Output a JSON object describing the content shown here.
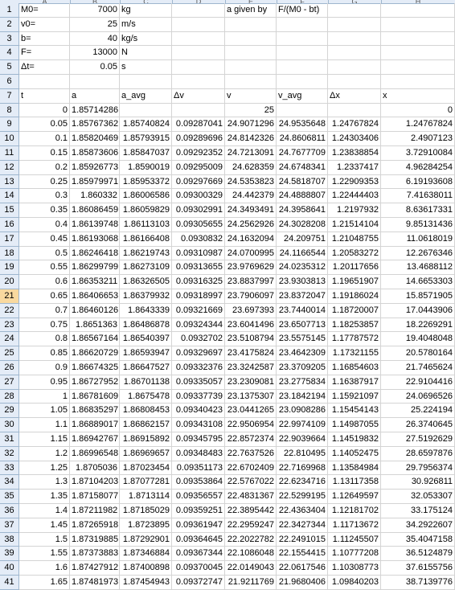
{
  "column_headers": [
    "A",
    "B",
    "C",
    "D",
    "E",
    "F",
    "G",
    "H"
  ],
  "selected_row": "21",
  "params": [
    {
      "row": "1",
      "A": "M0=",
      "B": "7000",
      "C": "kg",
      "E": "a given by",
      "F": "F/(M0 - bt)"
    },
    {
      "row": "2",
      "A": "v0=",
      "B": "25",
      "C": "m/s"
    },
    {
      "row": "3",
      "A": "b=",
      "B": "40",
      "C": "kg/s"
    },
    {
      "row": "4",
      "A": "F=",
      "B": "13000",
      "C": "N"
    },
    {
      "row": "5",
      "A": "Δt=",
      "B": "0.05",
      "C": "s"
    },
    {
      "row": "6"
    },
    {
      "row": "7",
      "A": "t",
      "B": "a",
      "C": "a_avg",
      "D": "Δv",
      "E": "v",
      "F": "v_avg",
      "G": "Δx",
      "H": "x"
    },
    {
      "row": "8",
      "A": "0",
      "B": "1.85714286",
      "E": "25",
      "H": "0"
    }
  ],
  "data_rows": [
    [
      "9",
      "0.05",
      "1.85767362",
      "1.85740824",
      "0.09287041",
      "24.9071296",
      "24.9535648",
      "1.24767824",
      "1.24767824"
    ],
    [
      "10",
      "0.1",
      "1.85820469",
      "1.85793915",
      "0.09289696",
      "24.8142326",
      "24.8606811",
      "1.24303406",
      "2.4907123"
    ],
    [
      "11",
      "0.15",
      "1.85873606",
      "1.85847037",
      "0.09292352",
      "24.7213091",
      "24.7677709",
      "1.23838854",
      "3.72910084"
    ],
    [
      "12",
      "0.2",
      "1.85926773",
      "1.8590019",
      "0.09295009",
      "24.628359",
      "24.6748341",
      "1.2337417",
      "4.96284254"
    ],
    [
      "13",
      "0.25",
      "1.85979971",
      "1.85953372",
      "0.09297669",
      "24.5353823",
      "24.5818707",
      "1.22909353",
      "6.19193608"
    ],
    [
      "14",
      "0.3",
      "1.860332",
      "1.86006586",
      "0.09300329",
      "24.442379",
      "24.4888807",
      "1.22444403",
      "7.41638011"
    ],
    [
      "15",
      "0.35",
      "1.86086459",
      "1.86059829",
      "0.09302991",
      "24.3493491",
      "24.3958641",
      "1.2197932",
      "8.63617331"
    ],
    [
      "16",
      "0.4",
      "1.86139748",
      "1.86113103",
      "0.09305655",
      "24.2562926",
      "24.3028208",
      "1.21514104",
      "9.85131436"
    ],
    [
      "17",
      "0.45",
      "1.86193068",
      "1.86166408",
      "0.0930832",
      "24.1632094",
      "24.209751",
      "1.21048755",
      "11.0618019"
    ],
    [
      "18",
      "0.5",
      "1.86246418",
      "1.86219743",
      "0.09310987",
      "24.0700995",
      "24.1166544",
      "1.20583272",
      "12.2676346"
    ],
    [
      "19",
      "0.55",
      "1.86299799",
      "1.86273109",
      "0.09313655",
      "23.9769629",
      "24.0235312",
      "1.20117656",
      "13.4688112"
    ],
    [
      "20",
      "0.6",
      "1.86353211",
      "1.86326505",
      "0.09316325",
      "23.8837997",
      "23.9303813",
      "1.19651907",
      "14.6653303"
    ],
    [
      "21",
      "0.65",
      "1.86406653",
      "1.86379932",
      "0.09318997",
      "23.7906097",
      "23.8372047",
      "1.19186024",
      "15.8571905"
    ],
    [
      "22",
      "0.7",
      "1.86460126",
      "1.8643339",
      "0.09321669",
      "23.697393",
      "23.7440014",
      "1.18720007",
      "17.0443906"
    ],
    [
      "23",
      "0.75",
      "1.8651363",
      "1.86486878",
      "0.09324344",
      "23.6041496",
      "23.6507713",
      "1.18253857",
      "18.2269291"
    ],
    [
      "24",
      "0.8",
      "1.86567164",
      "1.86540397",
      "0.0932702",
      "23.5108794",
      "23.5575145",
      "1.17787572",
      "19.4048048"
    ],
    [
      "25",
      "0.85",
      "1.86620729",
      "1.86593947",
      "0.09329697",
      "23.4175824",
      "23.4642309",
      "1.17321155",
      "20.5780164"
    ],
    [
      "26",
      "0.9",
      "1.86674325",
      "1.86647527",
      "0.09332376",
      "23.3242587",
      "23.3709205",
      "1.16854603",
      "21.7465624"
    ],
    [
      "27",
      "0.95",
      "1.86727952",
      "1.86701138",
      "0.09335057",
      "23.2309081",
      "23.2775834",
      "1.16387917",
      "22.9104416"
    ],
    [
      "28",
      "1",
      "1.86781609",
      "1.8675478",
      "0.09337739",
      "23.1375307",
      "23.1842194",
      "1.15921097",
      "24.0696526"
    ],
    [
      "29",
      "1.05",
      "1.86835297",
      "1.86808453",
      "0.09340423",
      "23.0441265",
      "23.0908286",
      "1.15454143",
      "25.224194"
    ],
    [
      "30",
      "1.1",
      "1.86889017",
      "1.86862157",
      "0.09343108",
      "22.9506954",
      "22.9974109",
      "1.14987055",
      "26.3740645"
    ],
    [
      "31",
      "1.15",
      "1.86942767",
      "1.86915892",
      "0.09345795",
      "22.8572374",
      "22.9039664",
      "1.14519832",
      "27.5192629"
    ],
    [
      "32",
      "1.2",
      "1.86996548",
      "1.86969657",
      "0.09348483",
      "22.7637526",
      "22.810495",
      "1.14052475",
      "28.6597876"
    ],
    [
      "33",
      "1.25",
      "1.8705036",
      "1.87023454",
      "0.09351173",
      "22.6702409",
      "22.7169968",
      "1.13584984",
      "29.7956374"
    ],
    [
      "34",
      "1.3",
      "1.87104203",
      "1.87077281",
      "0.09353864",
      "22.5767022",
      "22.6234716",
      "1.13117358",
      "30.926811"
    ],
    [
      "35",
      "1.35",
      "1.87158077",
      "1.8713114",
      "0.09356557",
      "22.4831367",
      "22.5299195",
      "1.12649597",
      "32.053307"
    ],
    [
      "36",
      "1.4",
      "1.87211982",
      "1.87185029",
      "0.09359251",
      "22.3895442",
      "22.4363404",
      "1.12181702",
      "33.175124"
    ],
    [
      "37",
      "1.45",
      "1.87265918",
      "1.8723895",
      "0.09361947",
      "22.2959247",
      "22.3427344",
      "1.11713672",
      "34.2922607"
    ],
    [
      "38",
      "1.5",
      "1.87319885",
      "1.87292901",
      "0.09364645",
      "22.2022782",
      "22.2491015",
      "1.11245507",
      "35.4047158"
    ],
    [
      "39",
      "1.55",
      "1.87373883",
      "1.87346884",
      "0.09367344",
      "22.1086048",
      "22.1554415",
      "1.10777208",
      "36.5124879"
    ],
    [
      "40",
      "1.6",
      "1.87427912",
      "1.87400898",
      "0.09370045",
      "22.0149043",
      "22.0617546",
      "1.10308773",
      "37.6155756"
    ],
    [
      "41",
      "1.65",
      "1.87481973",
      "1.87454943",
      "0.09372747",
      "21.9211769",
      "21.9680406",
      "1.09840203",
      "38.7139776"
    ]
  ]
}
